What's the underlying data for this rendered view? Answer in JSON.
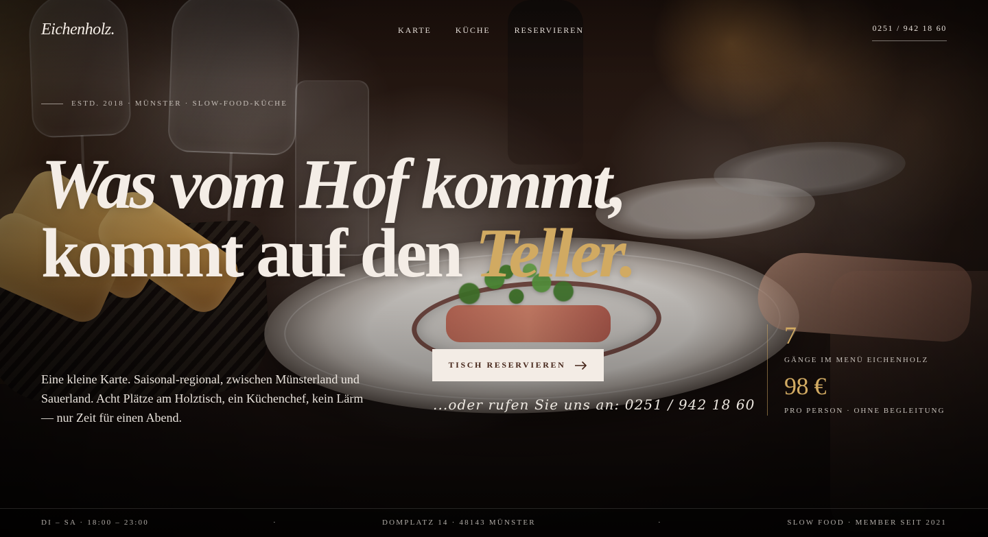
{
  "brand": {
    "logo": "Eichenholz."
  },
  "nav": {
    "items": [
      "KARTE",
      "KÜCHE",
      "RESERVIEREN"
    ]
  },
  "header": {
    "phone": "0251 / 942 18 60"
  },
  "hero": {
    "eyebrow": "ESTD. 2018 · MÜNSTER · SLOW-FOOD-KÜCHE",
    "headline_line1": "Was vom Hof kommt,",
    "headline_line2_prefix": "kommt auf den ",
    "headline_line2_accent": "Teller.",
    "intro": "Eine kleine Karte. Saisonal-regional, zwischen Münsterland und Sauerland. Acht Plätze am Holztisch, ein Küchenchef, kein Lärm — nur Zeit für einen Abend.",
    "cta_label": "TISCH RESERVIEREN",
    "call_text": "...oder rufen Sie uns an: 0251 / 942 18 60"
  },
  "stats": [
    {
      "value": "7",
      "label": "GÄNGE IM MENÜ EICHENHOLZ"
    },
    {
      "value": "98 €",
      "label": "PRO PERSON · OHNE BEGLEITUNG"
    }
  ],
  "footer": {
    "left": "DI – SA · 18:00 – 23:00",
    "center": "DOMPLATZ 14 · 48143 MÜNSTER",
    "right": "SLOW FOOD · MEMBER SEIT 2021",
    "dot": "·"
  },
  "colors": {
    "accent": "#d1aa62",
    "text": "#f4ede6",
    "button_bg": "#f3ece5",
    "button_text": "#452519"
  },
  "icons": {
    "arrow": "arrow-right-icon"
  }
}
